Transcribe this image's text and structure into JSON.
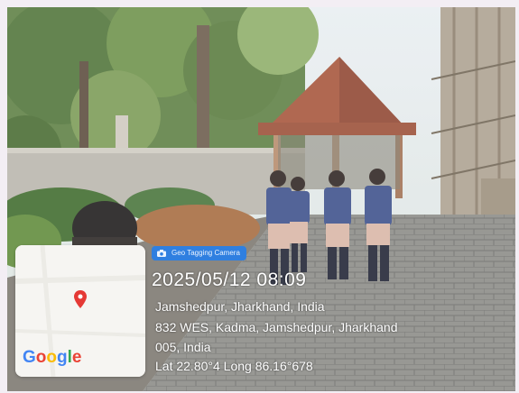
{
  "overlay": {
    "badge_text": "Geo Tagging Camera",
    "datetime": "2025/05/12 08:09",
    "address_lines": [
      "Jamshedpur, Jharkhand, India",
      "832 WES, Kadma, Jamshedpur, Jharkhand",
      "005, India",
      "Lat 22.80°4 Long 86.16°678"
    ]
  },
  "map": {
    "logo_letters": [
      "G",
      "o",
      "o",
      "g",
      "l",
      "e"
    ],
    "logo_colors": [
      "#4285F4",
      "#EA4335",
      "#FBBC05",
      "#4285F4",
      "#34A853",
      "#EA4335"
    ],
    "pin_color": "#e53935"
  },
  "icons": [
    "camera-icon",
    "map-pin-icon"
  ]
}
